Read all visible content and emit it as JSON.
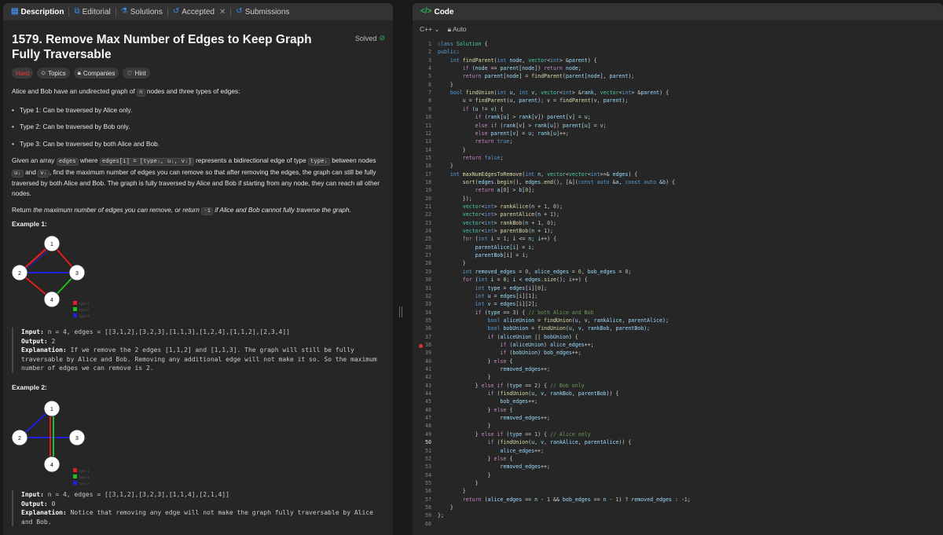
{
  "left_tabs": [
    {
      "label": "Description",
      "icon": "document-icon"
    },
    {
      "label": "Editorial",
      "icon": "book-icon"
    },
    {
      "label": "Solutions",
      "icon": "flask-icon"
    },
    {
      "label": "Accepted",
      "icon": "history-icon"
    },
    {
      "label": "Submissions",
      "icon": "history-icon"
    }
  ],
  "problem": {
    "title": "1579. Remove Max Number of Edges to Keep Graph Fully Traversable",
    "solved": "Solved",
    "tags": {
      "difficulty": "Hard",
      "topics": "Topics",
      "companies": "Companies",
      "hint": "Hint"
    },
    "desc": {
      "p1a": "Alice and Bob have an undirected graph of ",
      "p1n": "n",
      "p1b": " nodes and three types of edges:",
      "types": [
        "Type 1: Can be traversed by Alice only.",
        "Type 2: Can be traversed by Bob only.",
        "Type 3: Can be traversed by both Alice and Bob."
      ],
      "p2a": "Given an array ",
      "p2edges": "edges",
      "p2b": " where ",
      "p2code": "edges[i] = [typeᵢ, uᵢ, vᵢ]",
      "p2c": " represents a bidirectional edge of type ",
      "p2type": "typeᵢ",
      "p2d": " between nodes ",
      "p2u": "uᵢ",
      "p2e": " and ",
      "p2v": "vᵢ",
      "p2f": ", find the maximum number of edges you can remove so that after removing the edges, the graph can still be fully traversed by both Alice and Bob. The graph is fully traversed by Alice and Bob if starting from any node, they can reach all other nodes.",
      "p3a": "Return ",
      "p3em": "the maximum number of edges you can remove, or return",
      "p3code": "-1",
      "p3em2": " if Alice and Bob cannot fully traverse the graph."
    },
    "examples": [
      {
        "title": "Example 1:",
        "legend": [
          "Type 1",
          "Type 2",
          "Type 3"
        ],
        "nodes": [
          "1",
          "2",
          "3",
          "4"
        ],
        "input_label": "Input:",
        "input": " n = 4, edges = [[3,1,2],[3,2,3],[1,1,3],[1,2,4],[1,1,2],[2,3,4]]",
        "output_label": "Output:",
        "output": " 2",
        "expl_label": "Explanation:",
        "expl": " If we remove the 2 edges [1,1,2] and [1,1,3]. The graph will still be fully traversable by Alice and Bob. Removing any additional edge will not make it so. So the maximum number of edges we can remove is 2."
      },
      {
        "title": "Example 2:",
        "legend": [
          "Type 1",
          "Type 2",
          "Type 3"
        ],
        "nodes": [
          "1",
          "2",
          "3",
          "4"
        ],
        "input_label": "Input:",
        "input": " n = 4, edges = [[3,1,2],[3,2,3],[1,1,4],[2,1,4]]",
        "output_label": "Output:",
        "output": " 0",
        "expl_label": "Explanation:",
        "expl": " Notice that removing any edge will not make the graph fully traversable by Alice and Bob."
      }
    ]
  },
  "code_panel": {
    "title": "Code",
    "language": "C++",
    "mode": "Auto"
  },
  "colors": {
    "type1": "#e02020",
    "type2": "#20c020",
    "type3": "#2020e0"
  }
}
